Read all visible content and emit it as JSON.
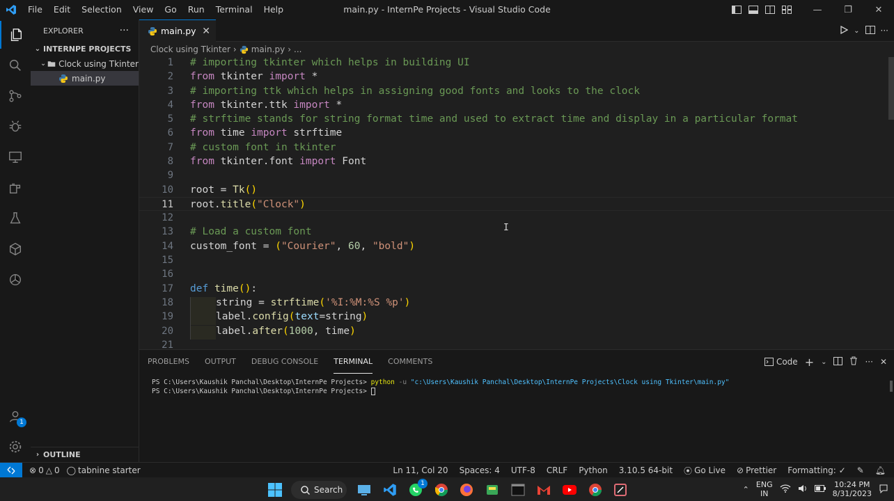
{
  "window": {
    "title": "main.py - InternPe Projects - Visual Studio Code",
    "menu": [
      "File",
      "Edit",
      "Selection",
      "View",
      "Go",
      "Run",
      "Terminal",
      "Help"
    ]
  },
  "sidebar": {
    "header": "EXPLORER",
    "more": "···",
    "project": "INTERNPE PROJECTS",
    "folder": "Clock using Tkinter",
    "file": "main.py",
    "outline": "OUTLINE"
  },
  "accounts_badge": "1",
  "editor": {
    "tab_label": "main.py",
    "breadcrumb": [
      "Clock using Tkinter",
      "main.py",
      "..."
    ],
    "line_numbers": [
      "1",
      "2",
      "3",
      "4",
      "5",
      "6",
      "7",
      "8",
      "9",
      "10",
      "11",
      "12",
      "13",
      "14",
      "15",
      "16",
      "17",
      "18",
      "19",
      "20",
      "21"
    ],
    "current_line": "11",
    "code": {
      "l1": "# importing tkinter which helps in building UI",
      "l2": {
        "kw1": "from",
        "mod": " tkinter ",
        "kw2": "import",
        "rest": " *"
      },
      "l3": "# importing ttk which helps in assigning good fonts and looks to the clock",
      "l4": {
        "kw1": "from",
        "mod": " tkinter.ttk ",
        "kw2": "import",
        "rest": " *"
      },
      "l5": "# strftime stands for string format time and used to extract time and display in a particular format",
      "l6": {
        "kw1": "from",
        "mod": " time ",
        "kw2": "import",
        "rest": " strftime"
      },
      "l7": "# custom font in tkinter",
      "l8": {
        "kw1": "from",
        "mod": " tkinter.font ",
        "kw2": "import",
        "rest": " Font"
      },
      "l10": {
        "a": "root = ",
        "fn": "Tk",
        "b1": "(",
        "b2": ")"
      },
      "l11": {
        "a": "root.",
        "fn": "title",
        "b1": "(",
        "s": "\"Clock\"",
        "b2": ")"
      },
      "l13": "# Load a custom font",
      "l14": {
        "a": "custom_font = ",
        "b1": "(",
        "s1": "\"Courier\"",
        "c1": ", ",
        "n": "60",
        "c2": ", ",
        "s2": "\"bold\"",
        "b2": ")"
      },
      "l17": {
        "kw": "def",
        "sp": " ",
        "fn": "time",
        "b": "()",
        "c": ":"
      },
      "l18": {
        "a": "string = ",
        "fn": "strftime",
        "b1": "(",
        "s": "'%I:%M:%S %p'",
        "b2": ")"
      },
      "l19": {
        "a": "label.",
        "fn": "config",
        "b1": "(",
        "p": "text",
        "eq": "=string",
        "b2": ")"
      },
      "l20": {
        "a": "label.",
        "fn": "after",
        "b1": "(",
        "n": "1000",
        "r": ", time",
        "b2": ")"
      }
    }
  },
  "panel": {
    "tabs": [
      "PROBLEMS",
      "OUTPUT",
      "DEBUG CONSOLE",
      "TERMINAL",
      "COMMENTS"
    ],
    "active_tab": "TERMINAL",
    "terminal_profile": "Code",
    "terminal_lines": {
      "prompt1": "PS C:\\Users\\Kaushik Panchal\\Desktop\\InternPe Projects> ",
      "cmd": "python",
      "flag": " -u ",
      "arg": "\"c:\\Users\\Kaushik Panchal\\Desktop\\InternPe Projects\\Clock using Tkinter\\main.py\"",
      "prompt2": "PS C:\\Users\\Kaushik Panchal\\Desktop\\InternPe Projects> "
    }
  },
  "statusbar": {
    "errors": "0",
    "warnings": "0",
    "tabnine": "tabnine starter",
    "position": "Ln 11, Col 20",
    "spaces": "Spaces: 4",
    "encoding": "UTF-8",
    "eol": "CRLF",
    "language": "Python",
    "interpreter": "3.10.5 64-bit",
    "golive": "Go Live",
    "prettier": "Prettier",
    "formatting": "Formatting: ✓"
  },
  "taskbar": {
    "search": "Search",
    "whatsapp_badge": "1",
    "lang": "ENG",
    "region": "IN",
    "time": "10:24 PM",
    "date": "8/31/2023"
  },
  "colors": {
    "accent": "#0078d4",
    "comment": "#6a9955",
    "keyword": "#c586c0",
    "string": "#ce9178"
  }
}
